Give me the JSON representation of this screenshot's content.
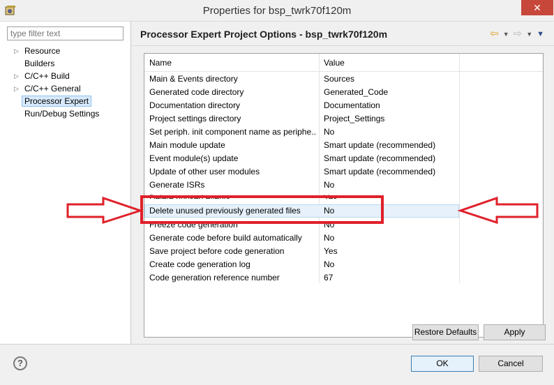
{
  "window": {
    "title": "Properties for bsp_twrk70f120m",
    "close_glyph": "✕"
  },
  "filter": {
    "placeholder": "type filter text"
  },
  "tree": [
    {
      "label": "Resource",
      "expandable": true
    },
    {
      "label": "Builders",
      "expandable": false
    },
    {
      "label": "C/C++ Build",
      "expandable": true
    },
    {
      "label": "C/C++ General",
      "expandable": true
    },
    {
      "label": "Processor Expert",
      "expandable": false,
      "selected": true
    },
    {
      "label": "Run/Debug Settings",
      "expandable": false
    }
  ],
  "page": {
    "title": "Processor Expert Project Options - bsp_twrk70f120m"
  },
  "table": {
    "headers": {
      "name": "Name",
      "value": "Value"
    },
    "rows": [
      {
        "name": "Main & Events directory",
        "value": "Sources"
      },
      {
        "name": "Generated code directory",
        "value": "Generated_Code"
      },
      {
        "name": "Documentation directory",
        "value": "Documentation"
      },
      {
        "name": "Project settings directory",
        "value": "Project_Settings"
      },
      {
        "name": "Set periph. init component name as periphe...",
        "value": "No"
      },
      {
        "name": "Main module update",
        "value": "Smart update (recommended)"
      },
      {
        "name": "Event module(s) update",
        "value": "Smart update (recommended)"
      },
      {
        "name": "Update of other user modules",
        "value": "Smart update (recommended)"
      },
      {
        "name": "Generate ISRs",
        "value": "No"
      },
      {
        "name": "Delete unused events",
        "value": "Yes"
      },
      {
        "name": "Delete unused previously generated files",
        "value": "No"
      },
      {
        "name": "Freeze code generation",
        "value": "No"
      },
      {
        "name": "Generate code before build automatically",
        "value": "No"
      },
      {
        "name": "Save project before code generation",
        "value": "Yes"
      },
      {
        "name": "Create code generation log",
        "value": "No"
      },
      {
        "name": "Code generation reference number",
        "value": "67"
      }
    ]
  },
  "buttons": {
    "restore_defaults": "Restore Defaults",
    "apply": "Apply",
    "ok": "OK",
    "cancel": "Cancel",
    "help": "?"
  },
  "colors": {
    "annotation_red": "#e0202a",
    "selection_bg": "#e6f1fb"
  }
}
